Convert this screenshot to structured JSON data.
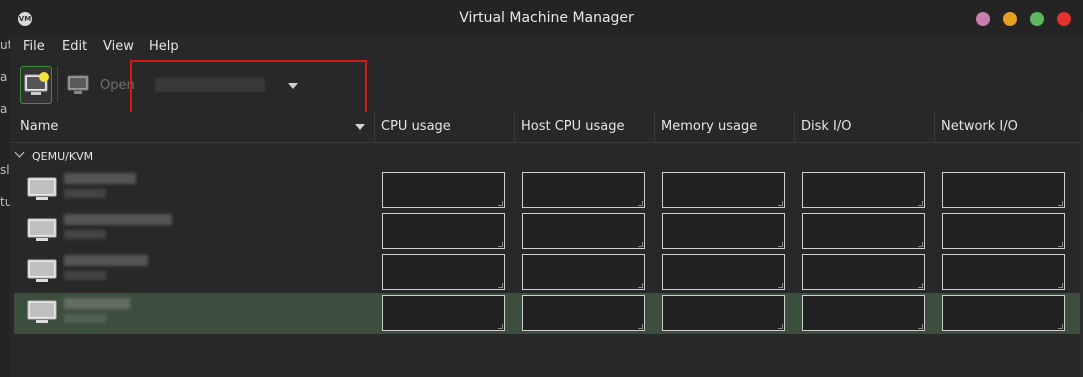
{
  "window": {
    "title": "Virtual Machine Manager",
    "app_icon_text": "VM",
    "controls": {
      "minimize_color": "#c87fb0",
      "maximize_color": "#e6a020",
      "restore_color": "#5fb85f",
      "close_color": "#e0342f"
    }
  },
  "background_edge_text": [
    "ut",
    "a",
    "a",
    "sl",
    "tu"
  ],
  "menubar": {
    "items": [
      "File",
      "Edit",
      "View",
      "Help"
    ]
  },
  "toolbar": {
    "open_label": "Open",
    "highlight_color": "#d41919"
  },
  "columns": [
    "Name",
    "CPU usage",
    "Host CPU usage",
    "Memory usage",
    "Disk I/O",
    "Network I/O"
  ],
  "list": {
    "group_label": "QEMU/KVM",
    "vm_rows": [
      {
        "selected": false
      },
      {
        "selected": false
      },
      {
        "selected": false
      },
      {
        "selected": true
      }
    ]
  },
  "colors": {
    "selection": "#3c4f3d",
    "window_bg": "#282828"
  }
}
